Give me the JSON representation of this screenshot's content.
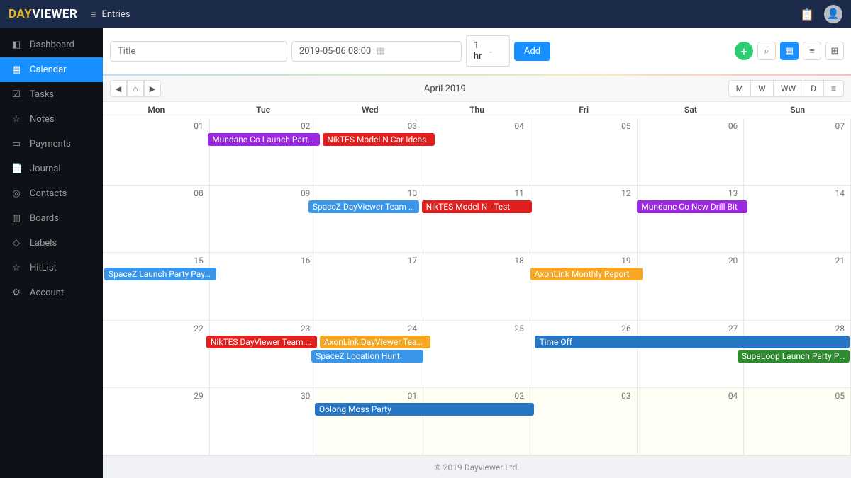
{
  "header": {
    "logo_left": "DAY",
    "logo_right": "VIEWER",
    "entries": "Entries"
  },
  "sidebar": [
    {
      "icon": "◧",
      "label": "Dashboard"
    },
    {
      "icon": "▦",
      "label": "Calendar",
      "active": true
    },
    {
      "icon": "☑",
      "label": "Tasks"
    },
    {
      "icon": "☆",
      "label": "Notes"
    },
    {
      "icon": "▭",
      "label": "Payments"
    },
    {
      "icon": "📄",
      "label": "Journal"
    },
    {
      "icon": "◎",
      "label": "Contacts"
    },
    {
      "icon": "▥",
      "label": "Boards"
    },
    {
      "icon": "◇",
      "label": "Labels"
    },
    {
      "icon": "☆",
      "label": "HitList"
    },
    {
      "icon": "⚙",
      "label": "Account"
    }
  ],
  "toolbar": {
    "title_ph": "Title",
    "date": "2019-05-06 08:00",
    "duration": "1 hr",
    "add": "Add"
  },
  "calnav": {
    "title": "April 2019",
    "views": [
      "M",
      "W",
      "WW",
      "D",
      "≡"
    ]
  },
  "dayhdr": [
    "Mon",
    "Tue",
    "Wed",
    "Thu",
    "Fri",
    "Sat",
    "Sun"
  ],
  "weeks": [
    {
      "days": [
        {
          "n": "01"
        },
        {
          "n": "02"
        },
        {
          "n": "03"
        },
        {
          "n": "04"
        },
        {
          "n": "05"
        },
        {
          "n": "06"
        },
        {
          "n": "07"
        }
      ],
      "events": [
        {
          "col": 1,
          "span": 1,
          "color": "#9b27e0",
          "text": "Mundane Co Launch Party ..."
        },
        {
          "col": 2,
          "span": 1,
          "color": "#e01f1f",
          "text": "NikTES Model N Car Ideas"
        }
      ]
    },
    {
      "days": [
        {
          "n": "08"
        },
        {
          "n": "09"
        },
        {
          "n": "10"
        },
        {
          "n": "11"
        },
        {
          "n": "12"
        },
        {
          "n": "13"
        },
        {
          "n": "14"
        }
      ],
      "events": [
        {
          "col": 2,
          "span": 1,
          "color": "#3a96e8",
          "text": "SpaceZ DayViewer Team Ro..."
        },
        {
          "col": 3,
          "span": 1,
          "color": "#e01f1f",
          "text": "NikTES Model N - Test"
        },
        {
          "col": 5,
          "span": 1,
          "color": "#9b27e0",
          "text": "Mundane Co New Drill Bit"
        }
      ]
    },
    {
      "days": [
        {
          "n": "15"
        },
        {
          "n": "16"
        },
        {
          "n": "17"
        },
        {
          "n": "18"
        },
        {
          "n": "19"
        },
        {
          "n": "20"
        },
        {
          "n": "21"
        }
      ],
      "events": [
        {
          "col": 0,
          "span": 1,
          "color": "#3a96e8",
          "text": "SpaceZ Launch Party Paym..."
        },
        {
          "col": 4,
          "span": 1,
          "color": "#f5a623",
          "text": "AxonLink Monthly Report"
        }
      ]
    },
    {
      "days": [
        {
          "n": "22"
        },
        {
          "n": "23"
        },
        {
          "n": "24"
        },
        {
          "n": "25"
        },
        {
          "n": "26"
        },
        {
          "n": "27"
        },
        {
          "n": "28"
        }
      ],
      "events": [
        {
          "col": 1,
          "span": 1,
          "color": "#e01f1f",
          "text": "NikTES DayViewer Team Room"
        },
        {
          "col": 2,
          "span": 1,
          "color": "#f5a623",
          "text": "AxonLink DayViewer Team ..."
        },
        {
          "col": 4,
          "span": 3,
          "color": "#2776c4",
          "text": "Time Off"
        }
      ],
      "events2": [
        {
          "col": 2,
          "span": 1,
          "color": "#3a96e8",
          "text": "SpaceZ Location Hunt"
        },
        {
          "col": 6,
          "span": 1,
          "color": "#2d8a2d",
          "text": "SupaLoop Launch Party Pa..."
        }
      ]
    },
    {
      "days": [
        {
          "n": "29"
        },
        {
          "n": "30"
        },
        {
          "n": "01",
          "out": true
        },
        {
          "n": "02",
          "out": true
        },
        {
          "n": "03",
          "out": true
        },
        {
          "n": "04",
          "out": true
        },
        {
          "n": "05",
          "out": true
        }
      ],
      "events": [
        {
          "col": 2,
          "span": 2,
          "color": "#2776c4",
          "text": "Oolong Moss Party"
        }
      ]
    }
  ],
  "footer": "© 2019 Dayviewer Ltd."
}
